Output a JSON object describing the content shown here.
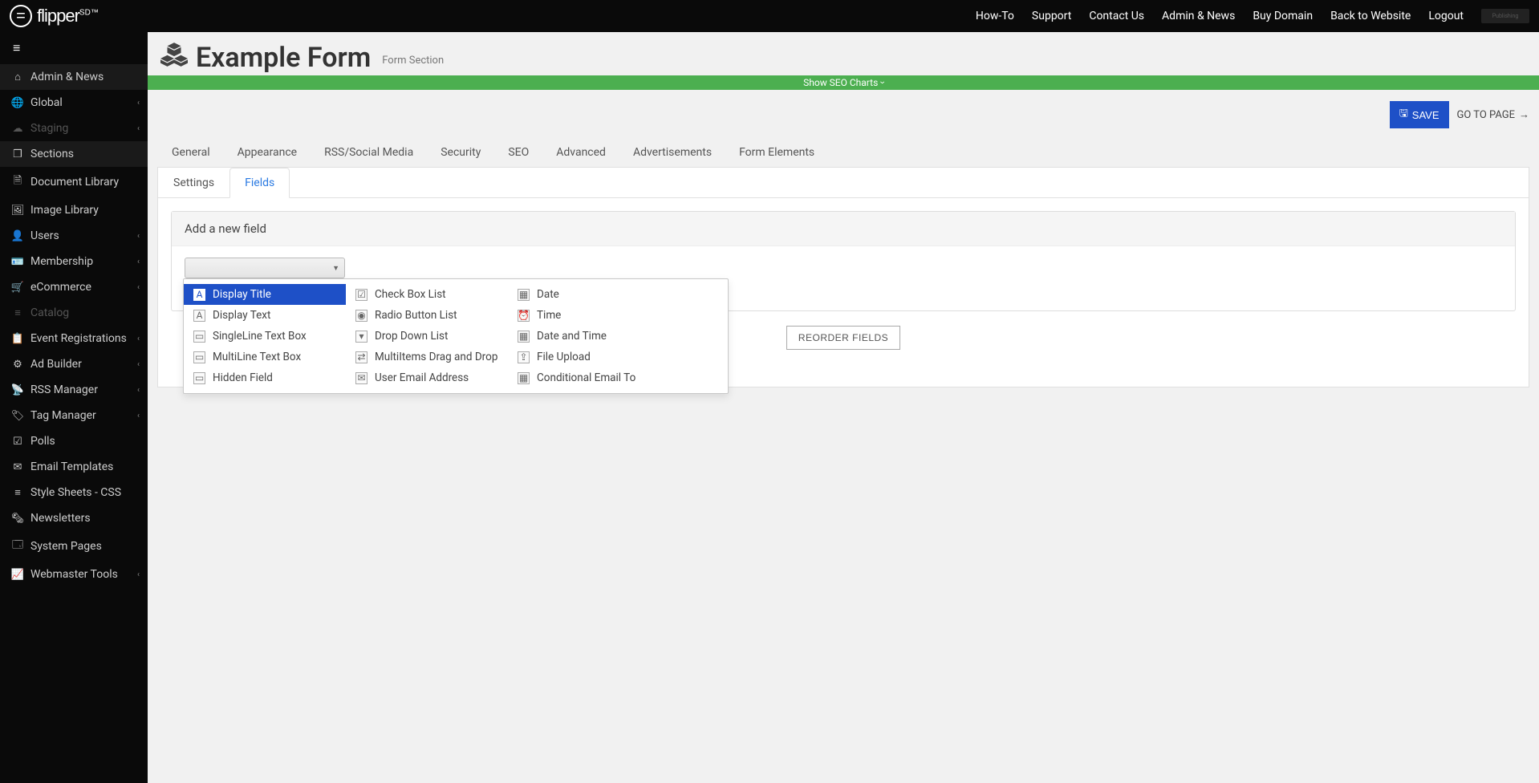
{
  "topnav": [
    "How-To",
    "Support",
    "Contact Us",
    "Admin & News",
    "Buy Domain",
    "Back to Website",
    "Logout"
  ],
  "logo": {
    "text": "flipper",
    "suffix": "SD™"
  },
  "sidebar": [
    {
      "icon": "home",
      "label": "Admin & News",
      "expandable": false,
      "active": true
    },
    {
      "icon": "globe",
      "label": "Global",
      "expandable": true
    },
    {
      "icon": "cloud",
      "label": "Staging",
      "expandable": true,
      "disabled": true
    },
    {
      "icon": "cubes",
      "label": "Sections",
      "expandable": false,
      "active": true
    },
    {
      "icon": "doc",
      "label": "Document Library",
      "expandable": false
    },
    {
      "icon": "img",
      "label": "Image Library",
      "expandable": false
    },
    {
      "icon": "user",
      "label": "Users",
      "expandable": true
    },
    {
      "icon": "id",
      "label": "Membership",
      "expandable": true
    },
    {
      "icon": "cart",
      "label": "eCommerce",
      "expandable": true
    },
    {
      "icon": "list",
      "label": "Catalog",
      "expandable": false,
      "disabled": true
    },
    {
      "icon": "cal",
      "label": "Event Registrations",
      "expandable": true
    },
    {
      "icon": "gears",
      "label": "Ad Builder",
      "expandable": true
    },
    {
      "icon": "rss",
      "label": "RSS Manager",
      "expandable": true
    },
    {
      "icon": "tag",
      "label": "Tag Manager",
      "expandable": true
    },
    {
      "icon": "check",
      "label": "Polls",
      "expandable": false
    },
    {
      "icon": "mail",
      "label": "Email Templates",
      "expandable": false
    },
    {
      "icon": "css",
      "label": "Style Sheets - CSS",
      "expandable": false
    },
    {
      "icon": "news",
      "label": "Newsletters",
      "expandable": false
    },
    {
      "icon": "sys",
      "label": "System Pages",
      "expandable": false
    },
    {
      "icon": "chart",
      "label": "Webmaster Tools",
      "expandable": true
    }
  ],
  "page": {
    "title": "Example Form",
    "subtitle": "Form Section",
    "seo_bar": "Show SEO Charts",
    "save_label": "SAVE",
    "goto_label": "GO TO PAGE"
  },
  "tabs": [
    "General",
    "Appearance",
    "RSS/Social Media",
    "Security",
    "SEO",
    "Advanced",
    "Advertisements",
    "Form Elements"
  ],
  "subtabs": [
    "Settings",
    "Fields"
  ],
  "active_subtab": 1,
  "field_panel": {
    "header": "Add a new field",
    "reorder_label": "REORDER FIELDS"
  },
  "dropdown": {
    "columns": [
      [
        {
          "icon": "A",
          "label": "Display Title",
          "selected": true
        },
        {
          "icon": "A",
          "label": "Display Text"
        },
        {
          "icon": "▭",
          "label": "SingleLine Text Box"
        },
        {
          "icon": "▭",
          "label": "MultiLine Text Box"
        },
        {
          "icon": "▭",
          "label": "Hidden Field"
        }
      ],
      [
        {
          "icon": "☑",
          "label": "Check Box List"
        },
        {
          "icon": "◉",
          "label": "Radio Button List"
        },
        {
          "icon": "▾",
          "label": "Drop Down List"
        },
        {
          "icon": "⇄",
          "label": "MultiItems Drag and Drop"
        },
        {
          "icon": "✉",
          "label": "User Email Address"
        }
      ],
      [
        {
          "icon": "▦",
          "label": "Date"
        },
        {
          "icon": "⏰",
          "label": "Time"
        },
        {
          "icon": "▦",
          "label": "Date and Time"
        },
        {
          "icon": "⇪",
          "label": "File Upload"
        },
        {
          "icon": "▦",
          "label": "Conditional Email To"
        }
      ]
    ]
  },
  "icons": {
    "home": "⌂",
    "globe": "🌐",
    "cloud": "☁",
    "cubes": "❒",
    "doc": "🗎",
    "img": "🖼",
    "user": "👤",
    "id": "🪪",
    "cart": "🛒",
    "list": "≡",
    "cal": "📋",
    "gears": "⚙",
    "rss": "📡",
    "tag": "🏷",
    "check": "☑",
    "mail": "✉",
    "css": "≡",
    "news": "🗞",
    "sys": "🗔",
    "chart": "📈"
  }
}
